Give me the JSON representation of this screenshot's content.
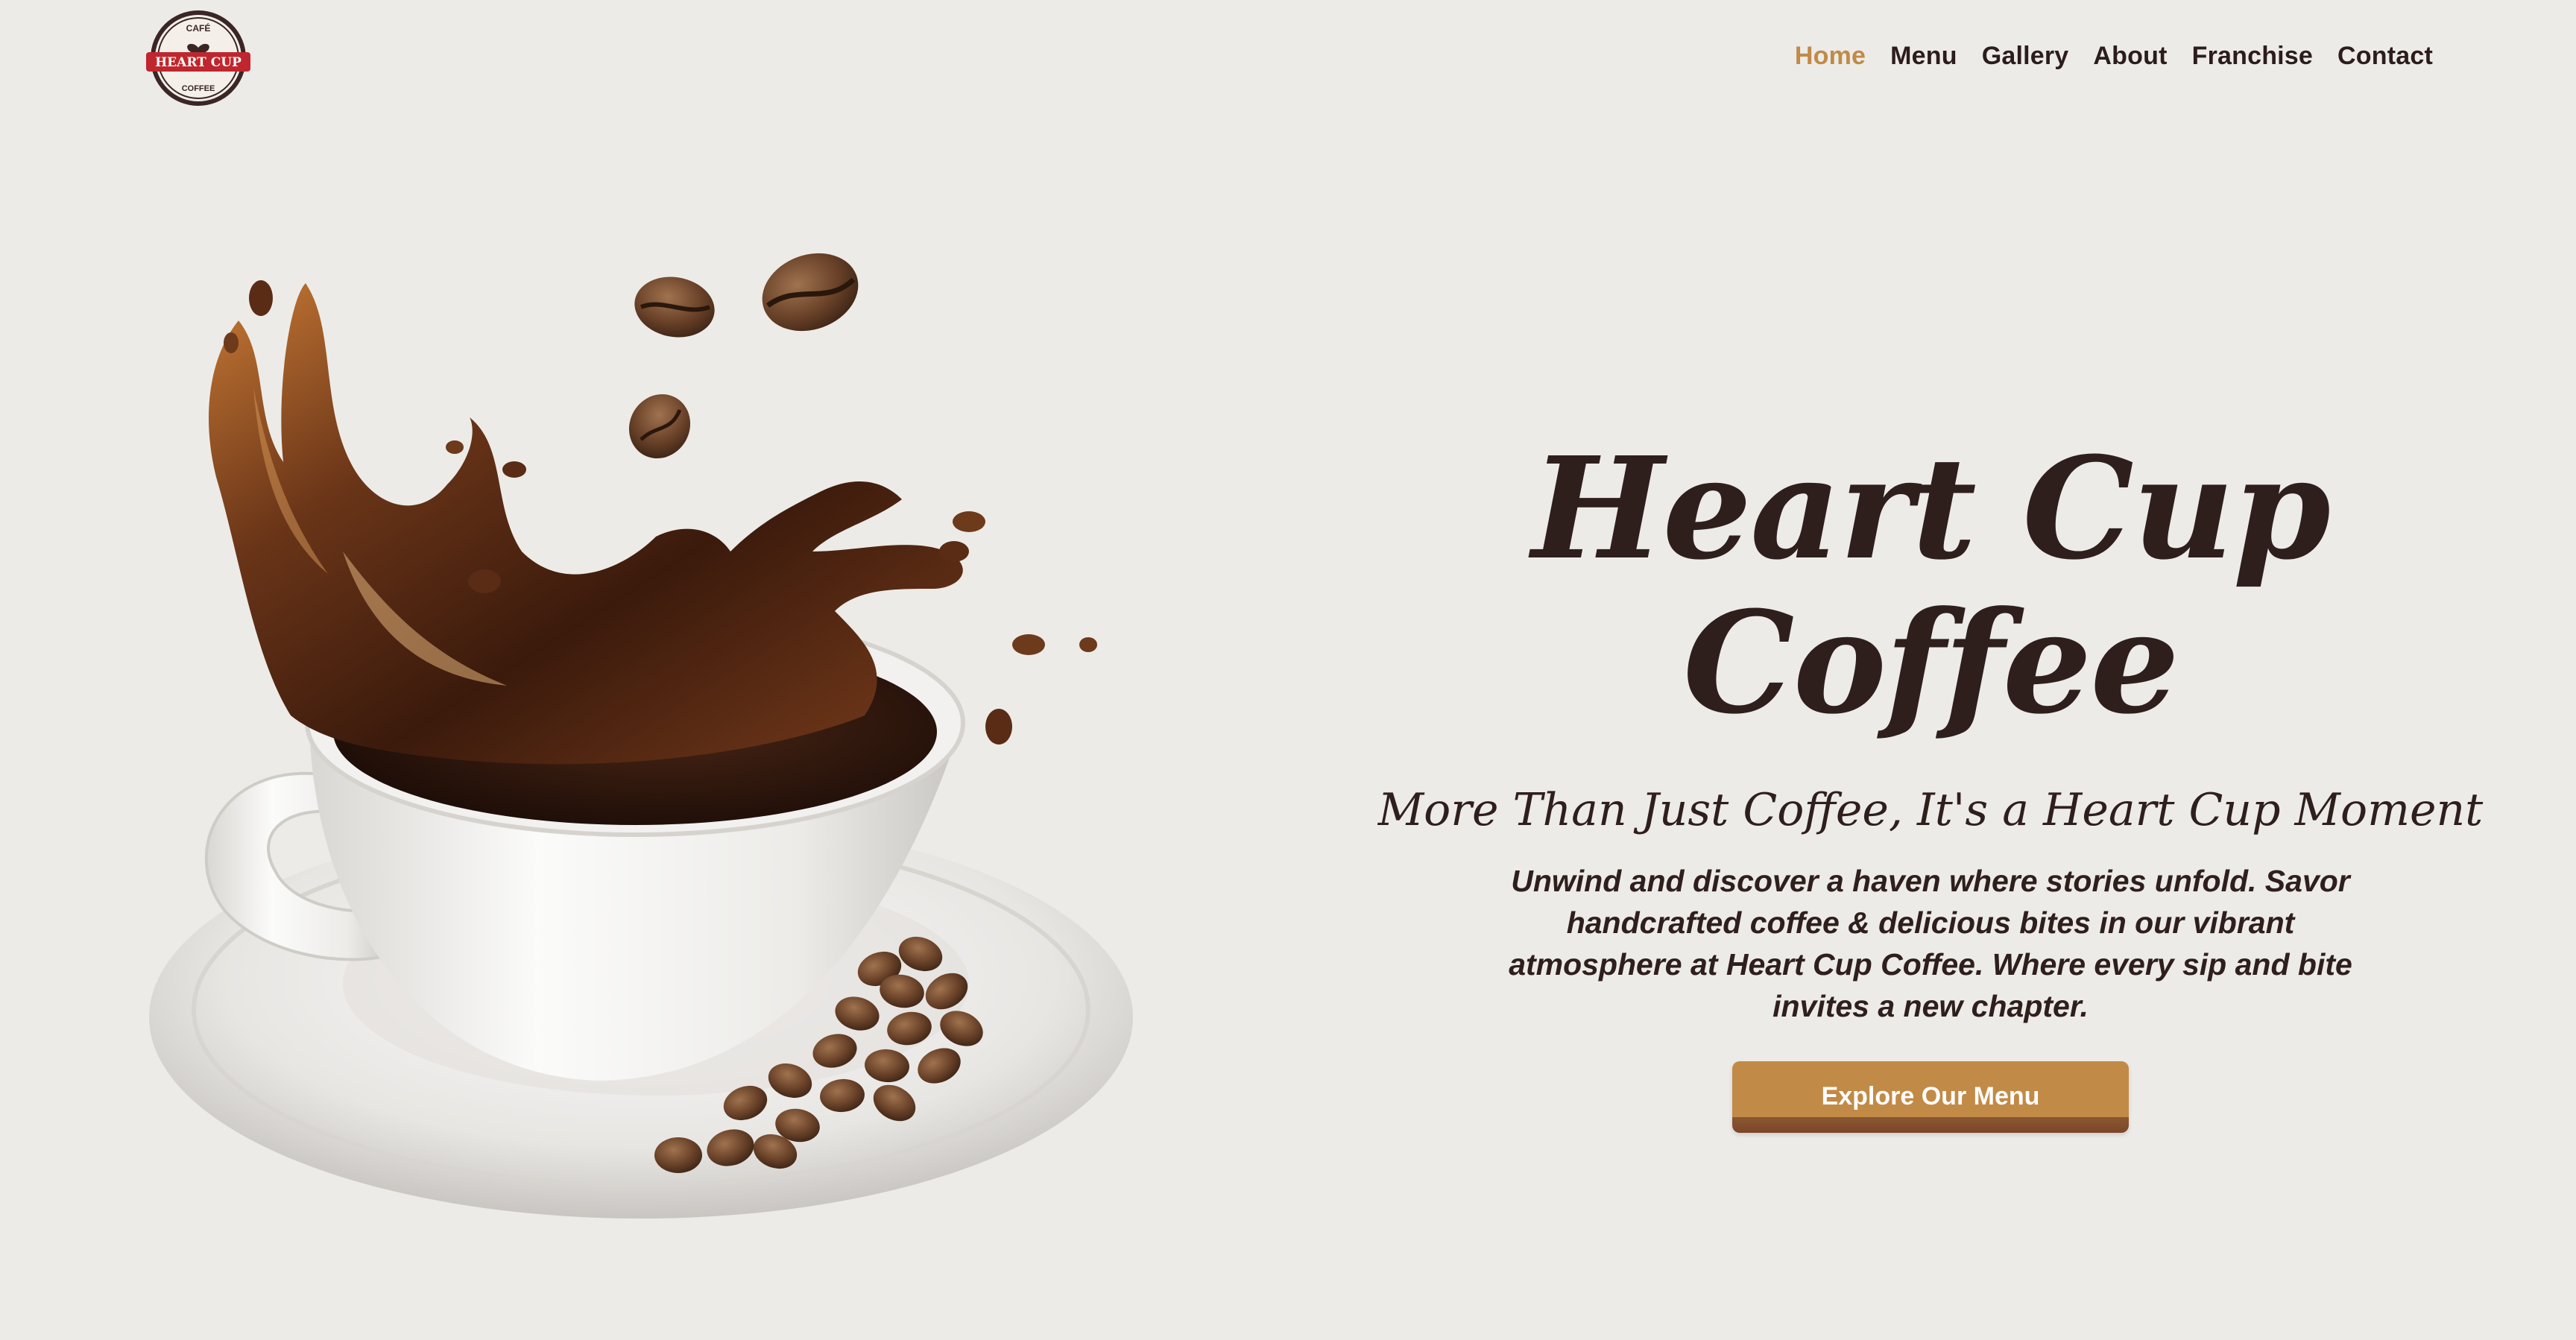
{
  "brand": {
    "logo": {
      "top_text": "CAFÉ",
      "name": "HEART CUP",
      "bottom_text": "COFFEE"
    }
  },
  "nav": {
    "items": [
      {
        "label": "Home",
        "active": true
      },
      {
        "label": "Menu",
        "active": false
      },
      {
        "label": "Gallery",
        "active": false
      },
      {
        "label": "About",
        "active": false
      },
      {
        "label": "Franchise",
        "active": false
      },
      {
        "label": "Contact",
        "active": false
      }
    ],
    "active_color": "#c08a48",
    "text_color": "#2b1d1b"
  },
  "hero": {
    "title": "Heart Cup Coffee",
    "subtitle": "More Than Just Coffee, It's a Heart Cup Moment",
    "description": "Unwind and discover a haven where stories unfold. Savor handcrafted coffee & delicious bites in our vibrant atmosphere at Heart Cup Coffee. Where every sip and bite invites a new chapter.",
    "cta_label": "Explore Our Menu",
    "image": "coffee-cup-splash-with-beans"
  },
  "colors": {
    "background": "#edebe7",
    "heading": "#2e1f1d",
    "accent": "#c28a47",
    "logo_red": "#c0262d"
  }
}
